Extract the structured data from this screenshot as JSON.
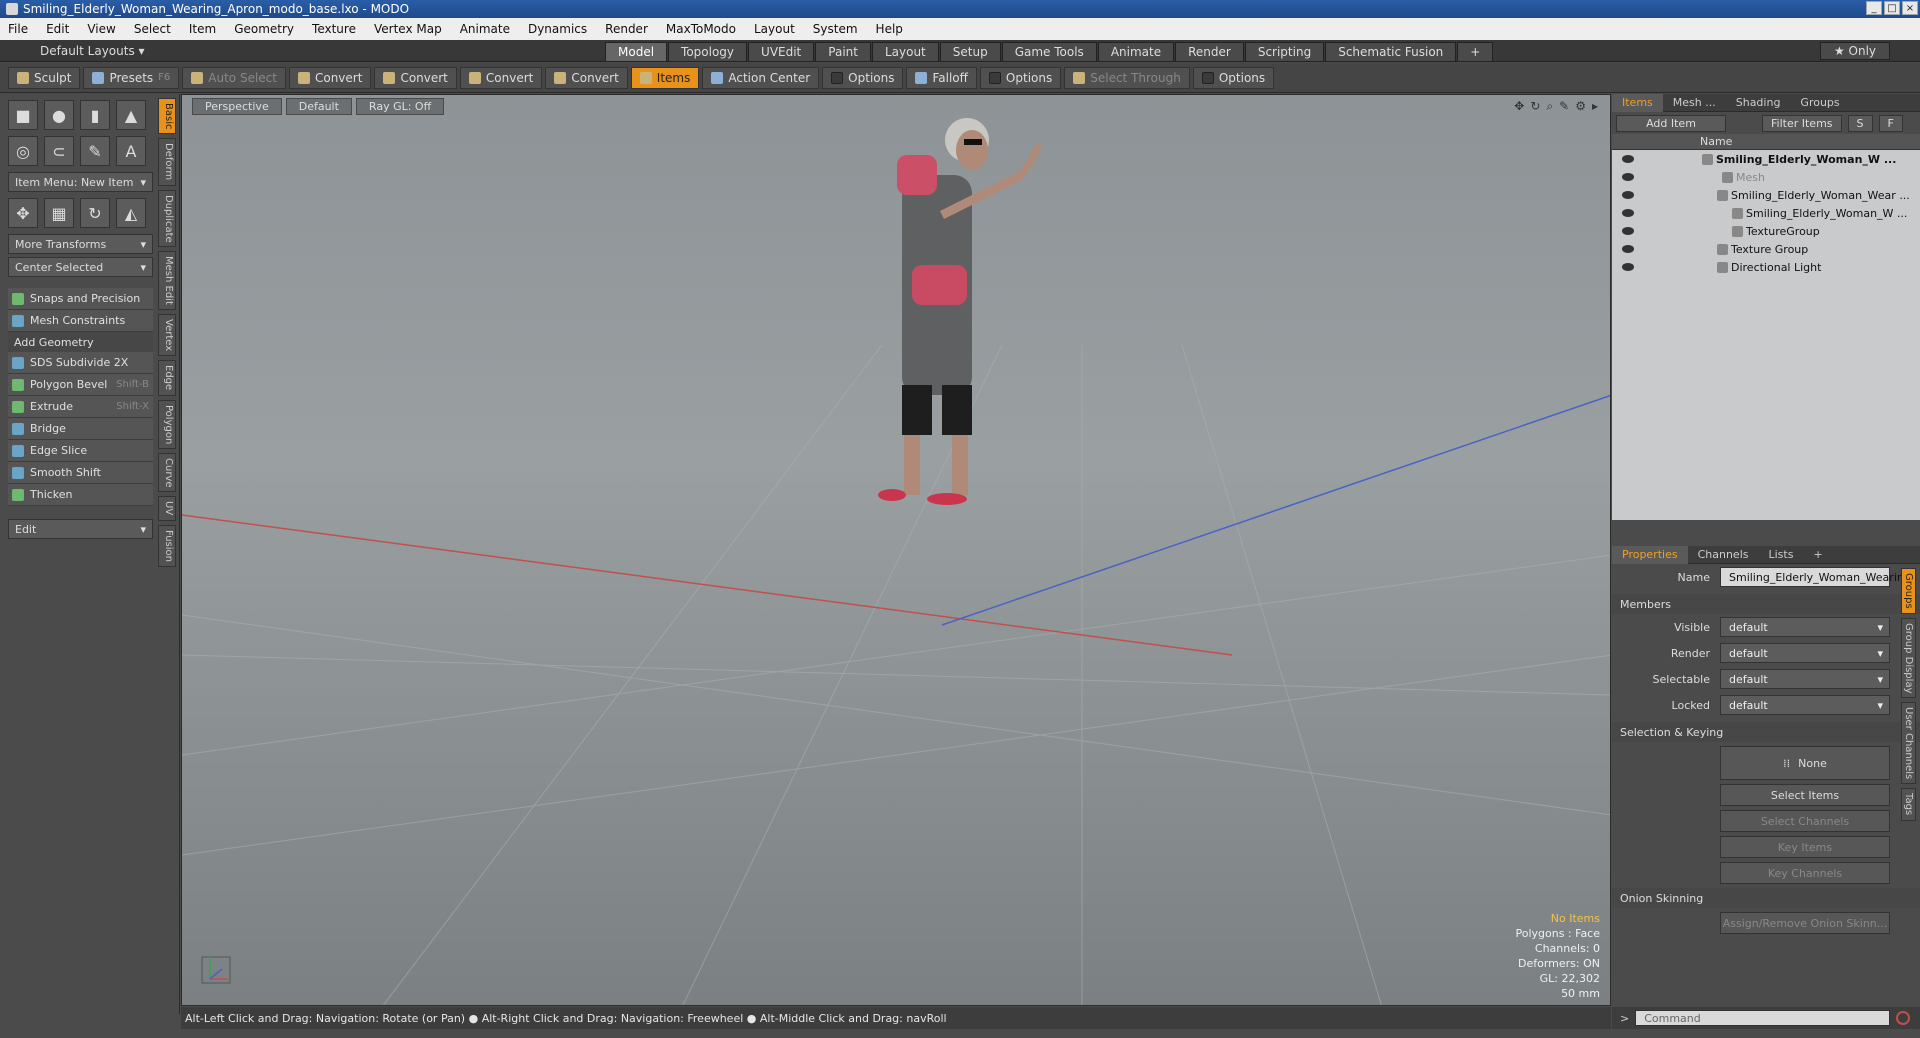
{
  "window": {
    "title": "Smiling_Elderly_Woman_Wearing_Apron_modo_base.lxo - MODO",
    "controls": [
      "_",
      "□",
      "×"
    ]
  },
  "menu": [
    "File",
    "Edit",
    "View",
    "Select",
    "Item",
    "Geometry",
    "Texture",
    "Vertex Map",
    "Animate",
    "Dynamics",
    "Render",
    "MaxToModo",
    "Layout",
    "System",
    "Help"
  ],
  "layout_bar": {
    "layouts_label": "Default Layouts ▾",
    "tabs": [
      "Model",
      "Topology",
      "UVEdit",
      "Paint",
      "Layout",
      "Setup",
      "Game Tools",
      "Animate",
      "Render",
      "Scripting",
      "Schematic Fusion",
      "+"
    ],
    "active": "Model",
    "only_label": "★ Only"
  },
  "toolbar": {
    "sculpt": "Sculpt",
    "presets": "Presets",
    "presets_key": "F6",
    "auto_select": "Auto Select",
    "convert1": "Convert",
    "convert2": "Convert",
    "convert3": "Convert",
    "convert4": "Convert",
    "items": "Items",
    "action_center": "Action Center",
    "options1": "Options",
    "falloff": "Falloff",
    "options2": "Options",
    "select_through": "Select Through",
    "options3": "Options"
  },
  "left": {
    "item_menu": "Item Menu: New Item",
    "more_transforms": "More Transforms",
    "center_selected": "Center Selected",
    "snaps": "Snaps and Precision",
    "mesh_constraints": "Mesh Constraints",
    "add_geometry": "Add Geometry",
    "tools": [
      {
        "label": "SDS Subdivide 2X",
        "shortcut": ""
      },
      {
        "label": "Polygon Bevel",
        "shortcut": "Shift-B"
      },
      {
        "label": "Extrude",
        "shortcut": "Shift-X"
      },
      {
        "label": "Bridge",
        "shortcut": ""
      },
      {
        "label": "Edge Slice",
        "shortcut": ""
      },
      {
        "label": "Smooth Shift",
        "shortcut": ""
      },
      {
        "label": "Thicken",
        "shortcut": ""
      }
    ],
    "edit": "Edit",
    "vtabs": [
      "Basic",
      "Deform",
      "Duplicate",
      "Mesh Edit",
      "Vertex",
      "Edge",
      "Polygon",
      "Curve",
      "UV",
      "Fusion"
    ]
  },
  "viewport": {
    "perspective": "Perspective",
    "default": "Default",
    "raygl": "Ray GL: Off",
    "stats": {
      "no_items": "No Items",
      "polygons": "Polygons : Face",
      "channels": "Channels: 0",
      "deformers": "Deformers: ON",
      "gl": "GL: 22,302",
      "focal": "50 mm"
    }
  },
  "status": "Alt-Left Click and Drag: Navigation: Rotate (or Pan) ● Alt-Right Click and Drag: Navigation: Freewheel ● Alt-Middle Click and Drag: navRoll",
  "items_panel": {
    "tabs": [
      "Items",
      "Mesh ...",
      "Shading",
      "Groups"
    ],
    "add_item": "Add Item",
    "filter_items": "Filter Items",
    "s": "S",
    "f": "F",
    "name_header": "Name",
    "tree": [
      {
        "label": "Smiling_Elderly_Woman_W ...",
        "indent": 90,
        "style": "bold"
      },
      {
        "label": "Mesh",
        "indent": 110,
        "style": "dim"
      },
      {
        "label": "Smiling_Elderly_Woman_Wear ...",
        "indent": 105,
        "style": ""
      },
      {
        "label": "Smiling_Elderly_Woman_W ...",
        "indent": 120,
        "style": ""
      },
      {
        "label": "TextureGroup",
        "indent": 120,
        "style": ""
      },
      {
        "label": "Texture Group",
        "indent": 105,
        "style": ""
      },
      {
        "label": "Directional Light",
        "indent": 105,
        "style": ""
      }
    ]
  },
  "properties": {
    "tabs": [
      "Properties",
      "Channels",
      "Lists",
      "+"
    ],
    "name_label": "Name",
    "name_value": "Smiling_Elderly_Woman_Wearing",
    "members": "Members",
    "fields": [
      {
        "label": "Visible",
        "value": "default"
      },
      {
        "label": "Render",
        "value": "default"
      },
      {
        "label": "Selectable",
        "value": "default"
      },
      {
        "label": "Locked",
        "value": "default"
      }
    ],
    "selection_keying": "Selection & Keying",
    "none": "None",
    "select_items": "Select Items",
    "select_channels": "Select Channels",
    "key_items": "Key Items",
    "key_channels": "Key Channels",
    "onion": "Onion Skinning",
    "assign_remove": "Assign/Remove Onion Skinn...",
    "vtabs": [
      "Groups",
      "Group Display",
      "User Channels",
      "Tags"
    ]
  },
  "command": {
    "placeholder": "Command"
  }
}
